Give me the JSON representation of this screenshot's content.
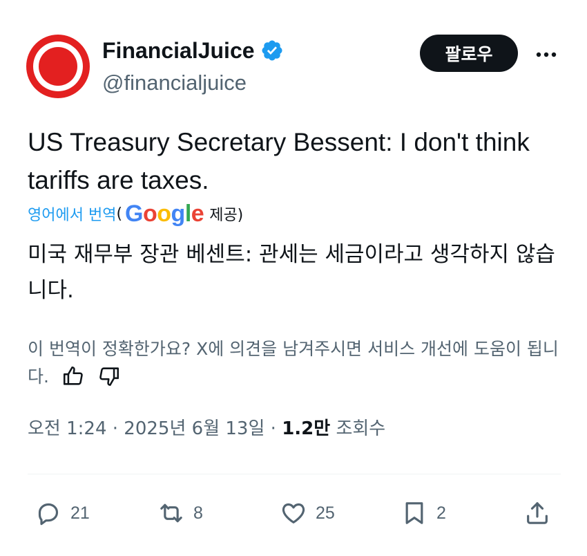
{
  "author": {
    "name": "FinancialJuice",
    "handle": "@financialjuice",
    "verified": true,
    "avatar_color": "#e32020"
  },
  "header": {
    "follow_label": "팔로우",
    "more_icon": "more-horizontal-icon"
  },
  "tweet": {
    "text": "US Treasury Secretary Bessent: I don't think tariffs are taxes."
  },
  "translation": {
    "link_label": "영어에서 번역",
    "open_paren": "(",
    "provider": "Google",
    "suffix": "제공)",
    "text": "미국 재무부 장관 베센트: 관세는 세금이라고 생각하지 않습니다.",
    "feedback_prompt": "이 번역이 정확한가요? X에 의견을 남겨주시면 서비스 개선에 도움이 됩니다."
  },
  "meta": {
    "time": "오전 1:24",
    "separator": "·",
    "date": "2025년 6월 13일",
    "views_count": "1.2만",
    "views_label": "조회수"
  },
  "actions": {
    "replies": "21",
    "reposts": "8",
    "likes": "25",
    "bookmarks": "2"
  },
  "colors": {
    "text": "#0f1419",
    "secondary": "#536471",
    "link": "#1d9bf0",
    "verified": "#1d9bf0"
  }
}
